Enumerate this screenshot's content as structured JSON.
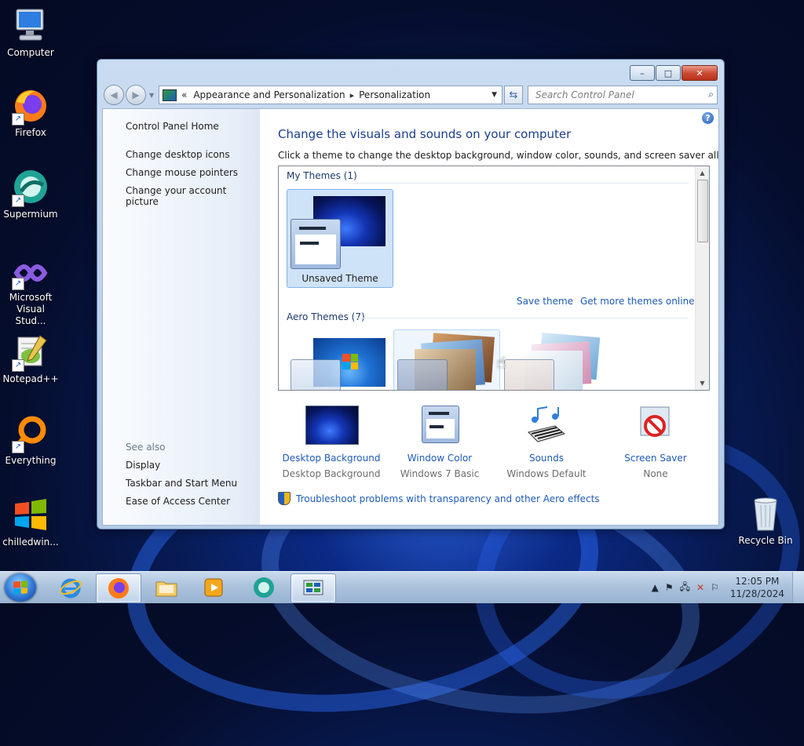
{
  "desktop": {
    "icons": [
      {
        "label": "Computer"
      },
      {
        "label": "Firefox"
      },
      {
        "label": "Supermium"
      },
      {
        "label": "Microsoft Visual Stud..."
      },
      {
        "label": "Notepad++"
      },
      {
        "label": "Everything"
      },
      {
        "label": "chilledwin..."
      },
      {
        "label": "Recycle Bin"
      }
    ]
  },
  "window": {
    "caption_buttons": {
      "minimize": "–",
      "maximize": "□",
      "close": "✕"
    },
    "address": {
      "chevron": "«",
      "crumbs": [
        "Appearance and Personalization",
        "Personalization"
      ],
      "separator": "▸"
    },
    "search": {
      "placeholder": "Search Control Panel"
    },
    "left_pane": {
      "home": "Control Panel Home",
      "links": [
        "Change desktop icons",
        "Change mouse pointers",
        "Change your account picture"
      ],
      "see_also_title": "See also",
      "see_also": [
        "Display",
        "Taskbar and Start Menu",
        "Ease of Access Center"
      ]
    },
    "main": {
      "heading": "Change the visuals and sounds on your computer",
      "subtext": "Click a theme to change the desktop background, window color, sounds, and screen saver all at once.",
      "my_themes_title": "My Themes (1)",
      "unsaved_theme": "Unsaved Theme",
      "save_theme": "Save theme",
      "get_more": "Get more themes online",
      "aero_title": "Aero Themes (7)"
    },
    "bottom": {
      "desktop_background": {
        "label": "Desktop Background",
        "value": "Desktop Background"
      },
      "window_color": {
        "label": "Window Color",
        "value": "Windows 7 Basic"
      },
      "sounds": {
        "label": "Sounds",
        "value": "Windows Default"
      },
      "screen_saver": {
        "label": "Screen Saver",
        "value": "None"
      }
    },
    "troubleshoot": "Troubleshoot problems with transparency and other Aero effects"
  },
  "taskbar": {
    "time": "12:05 PM",
    "date": "11/28/2024",
    "apps": [
      "internet-explorer",
      "firefox",
      "file-explorer",
      "media-player",
      "supermium",
      "control-panel"
    ]
  },
  "colors": {
    "link": "#1f5bb6",
    "heading": "#1a3e8c",
    "selection": "#cfe3f8"
  }
}
